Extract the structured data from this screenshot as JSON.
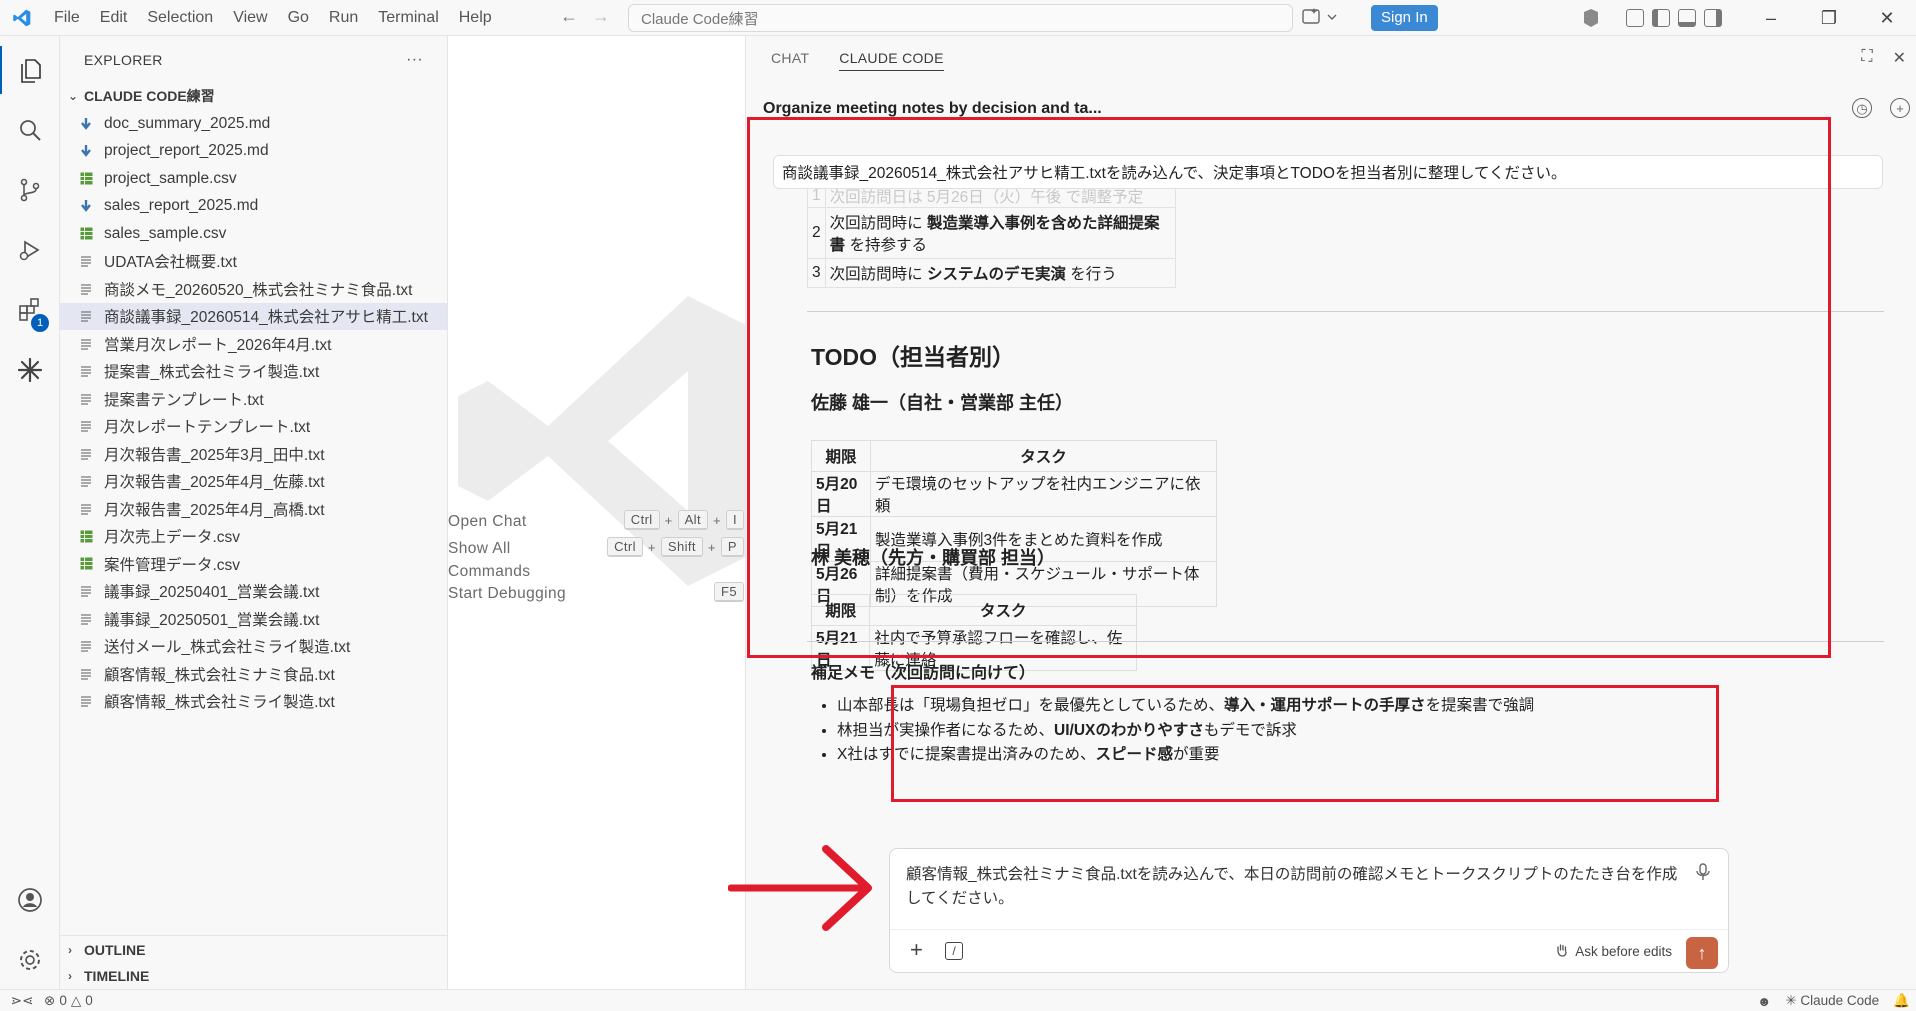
{
  "titlebar": {
    "menu": [
      "File",
      "Edit",
      "Selection",
      "View",
      "Go",
      "Run",
      "Terminal",
      "Help"
    ],
    "search_placeholder": "Claude Code練習",
    "sign_in": "Sign In"
  },
  "activity": {
    "extensions_badge": "1"
  },
  "explorer": {
    "header": "EXPLORER",
    "more": "···",
    "folder": "CLAUDE CODE練習",
    "files": [
      {
        "name": "doc_summary_2025.md",
        "type": "md"
      },
      {
        "name": "project_report_2025.md",
        "type": "md"
      },
      {
        "name": "project_sample.csv",
        "type": "csv"
      },
      {
        "name": "sales_report_2025.md",
        "type": "md"
      },
      {
        "name": "sales_sample.csv",
        "type": "csv"
      },
      {
        "name": "UDATA会社概要.txt",
        "type": "txt"
      },
      {
        "name": "商談メモ_20260520_株式会社ミナミ食品.txt",
        "type": "txt"
      },
      {
        "name": "商談議事録_20260514_株式会社アサヒ精工.txt",
        "type": "txt",
        "selected": true
      },
      {
        "name": "営業月次レポート_2026年4月.txt",
        "type": "txt"
      },
      {
        "name": "提案書_株式会社ミライ製造.txt",
        "type": "txt"
      },
      {
        "name": "提案書テンプレート.txt",
        "type": "txt"
      },
      {
        "name": "月次レポートテンプレート.txt",
        "type": "txt"
      },
      {
        "name": "月次報告書_2025年3月_田中.txt",
        "type": "txt"
      },
      {
        "name": "月次報告書_2025年4月_佐藤.txt",
        "type": "txt"
      },
      {
        "name": "月次報告書_2025年4月_高橋.txt",
        "type": "txt"
      },
      {
        "name": "月次売上データ.csv",
        "type": "csv"
      },
      {
        "name": "案件管理データ.csv",
        "type": "csv"
      },
      {
        "name": "議事録_20250401_営業会議.txt",
        "type": "txt"
      },
      {
        "name": "議事録_20250501_営業会議.txt",
        "type": "txt"
      },
      {
        "name": "送付メール_株式会社ミライ製造.txt",
        "type": "txt"
      },
      {
        "name": "顧客情報_株式会社ミナミ食品.txt",
        "type": "txt"
      },
      {
        "name": "顧客情報_株式会社ミライ製造.txt",
        "type": "txt"
      }
    ],
    "outline": "OUTLINE",
    "timeline": "TIMELINE"
  },
  "editor": {
    "shortcuts": [
      {
        "label": "Open Chat",
        "keys": [
          "Ctrl",
          "Alt",
          "I"
        ]
      },
      {
        "label": "Show All Commands",
        "keys": [
          "Ctrl",
          "Shift",
          "P"
        ]
      },
      {
        "label": "Start Debugging",
        "keys": [
          "F5"
        ]
      }
    ]
  },
  "panel": {
    "tabs": [
      "CHAT",
      "CLAUDE CODE"
    ],
    "active_tab": "CLAUDE CODE",
    "session_title": "Organize meeting notes by decision and ta...",
    "user_message": "商談議事録_20260514_株式会社アサヒ精工.txtを読み込んで、決定事項とTODOを担当者別に整理してください。",
    "prev_rows": [
      {
        "n": "1",
        "pre": "次回訪問日は 5月26日（火）午後 で調整予定",
        "bold": "",
        "post": "",
        "faded": true
      },
      {
        "n": "2",
        "pre": "次回訪問時に ",
        "bold": "製造業導入事例を含めた詳細提案書",
        "post": " を持参する"
      },
      {
        "n": "3",
        "pre": "次回訪問時に ",
        "bold": "システムのデモ実演",
        "post": " を行う"
      }
    ],
    "todo_heading": "TODO（担当者別）",
    "person1": "佐藤 雄一（自社・営業部 主任）",
    "person2": "林 美穂（先方・購買部 担当）",
    "col_deadline": "期限",
    "col_task": "タスク",
    "tasks1": [
      {
        "deadline": "5月20日",
        "task": "デモ環境のセットアップを社内エンジニアに依頼"
      },
      {
        "deadline": "5月21日",
        "task": "製造業導入事例3件をまとめた資料を作成"
      },
      {
        "deadline": "5月26日",
        "task": "詳細提案書（費用・スケジュール・サポート体制）を作成"
      }
    ],
    "tasks2": [
      {
        "deadline": "5月21日",
        "task": "社内で予算承認フローを確認し、佐藤に連絡"
      }
    ],
    "memo_heading": "補足メモ（次回訪問に向けて）",
    "memo_items": [
      {
        "pre": "山本部長は「現場負担ゼロ」を最優先としているため、",
        "bold": "導入・運用サポートの手厚さ",
        "post": "を提案書で強調"
      },
      {
        "pre": "林担当が実操作者になるため、",
        "bold": "UI/UXのわかりやすさ",
        "post": "もデモで訴求"
      },
      {
        "pre": "X社はすでに提案書提出済みのため、",
        "bold": "スピード感",
        "post": "が重要"
      }
    ],
    "composer_text": "顧客情報_株式会社ミナミ食品.txtを読み込んで、本日の訪問前の確認メモとトークスクリプトのたたき台を作成してください。",
    "ask_before_edits": "Ask before edits"
  },
  "statusbar": {
    "errors": "0",
    "warnings": "0",
    "claude_code": "Claude Code"
  },
  "colors": {
    "accent": "#005fb8",
    "highlight_box": "#e01b2b",
    "send": "#c96442",
    "sign_in": "#3b88d4"
  }
}
